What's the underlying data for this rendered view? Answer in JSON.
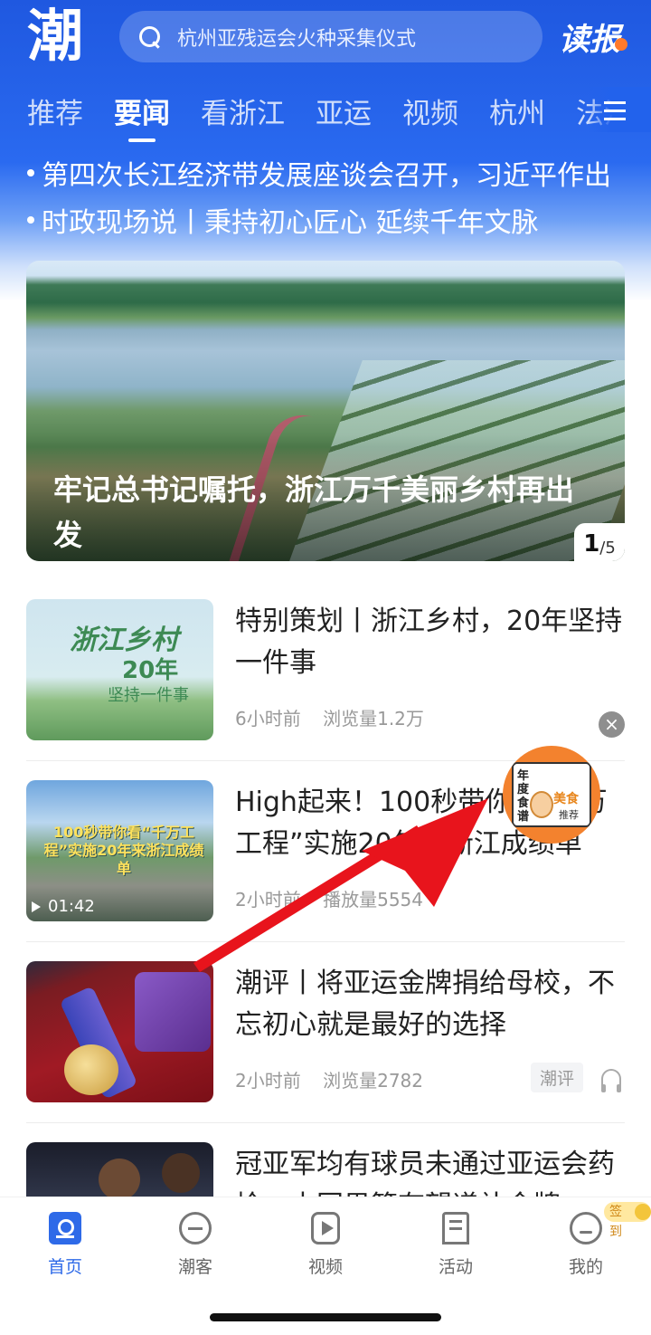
{
  "header": {
    "logo_text": "潮",
    "search_placeholder": "杭州亚残运会火种采集仪式",
    "dubao_label": "读报",
    "tabs": [
      "推荐",
      "要闻",
      "看浙江",
      "亚运",
      "视频",
      "杭州",
      "法治"
    ],
    "active_tab": "要闻"
  },
  "ticker": [
    "第四次长江经济带发展座谈会召开，习近平作出",
    "时政现场说丨秉持初心匠心 延续千年文脉"
  ],
  "hero": {
    "title": "牢记总书记嘱托，浙江万千美丽乡村再出发",
    "page_current": "1",
    "page_total": "/5"
  },
  "news": [
    {
      "title": "特别策划丨浙江乡村，20年坚持一件事",
      "time": "6小时前",
      "views": "浏览量1.2万",
      "thumb_lines": [
        "浙江乡村",
        "20年",
        "坚持一件事"
      ]
    },
    {
      "title": "High起来！100秒带你看“千万工程”实施20年来浙江成绩单",
      "time": "2小时前",
      "views": "播放量5554",
      "duration": "01:42",
      "thumb_caption": "100秒带你看“千万工程”实施20年来浙江成绩单"
    },
    {
      "title": "潮评丨将亚运金牌捐给母校，不忘初心就是最好的选择",
      "time": "2小时前",
      "views": "浏览量2782",
      "tag": "潮评"
    },
    {
      "title": "冠亚军均有球员未通过亚运会药检，中国男篮有望递补金牌"
    }
  ],
  "float_ad": {
    "line1": "年度食谱",
    "line2": "美食",
    "line3": "推荐"
  },
  "tabbar": {
    "items": [
      {
        "label": "首页",
        "icon": "home-icon",
        "active": true
      },
      {
        "label": "潮客",
        "icon": "chat-icon",
        "active": false
      },
      {
        "label": "视频",
        "icon": "video-icon",
        "active": false
      },
      {
        "label": "活动",
        "icon": "activity-icon",
        "active": false
      },
      {
        "label": "我的",
        "icon": "profile-icon",
        "active": false
      }
    ],
    "signin_label": "签到"
  },
  "colors": {
    "brand_blue": "#2e6ae8",
    "annotation_arrow": "#e8141c"
  }
}
